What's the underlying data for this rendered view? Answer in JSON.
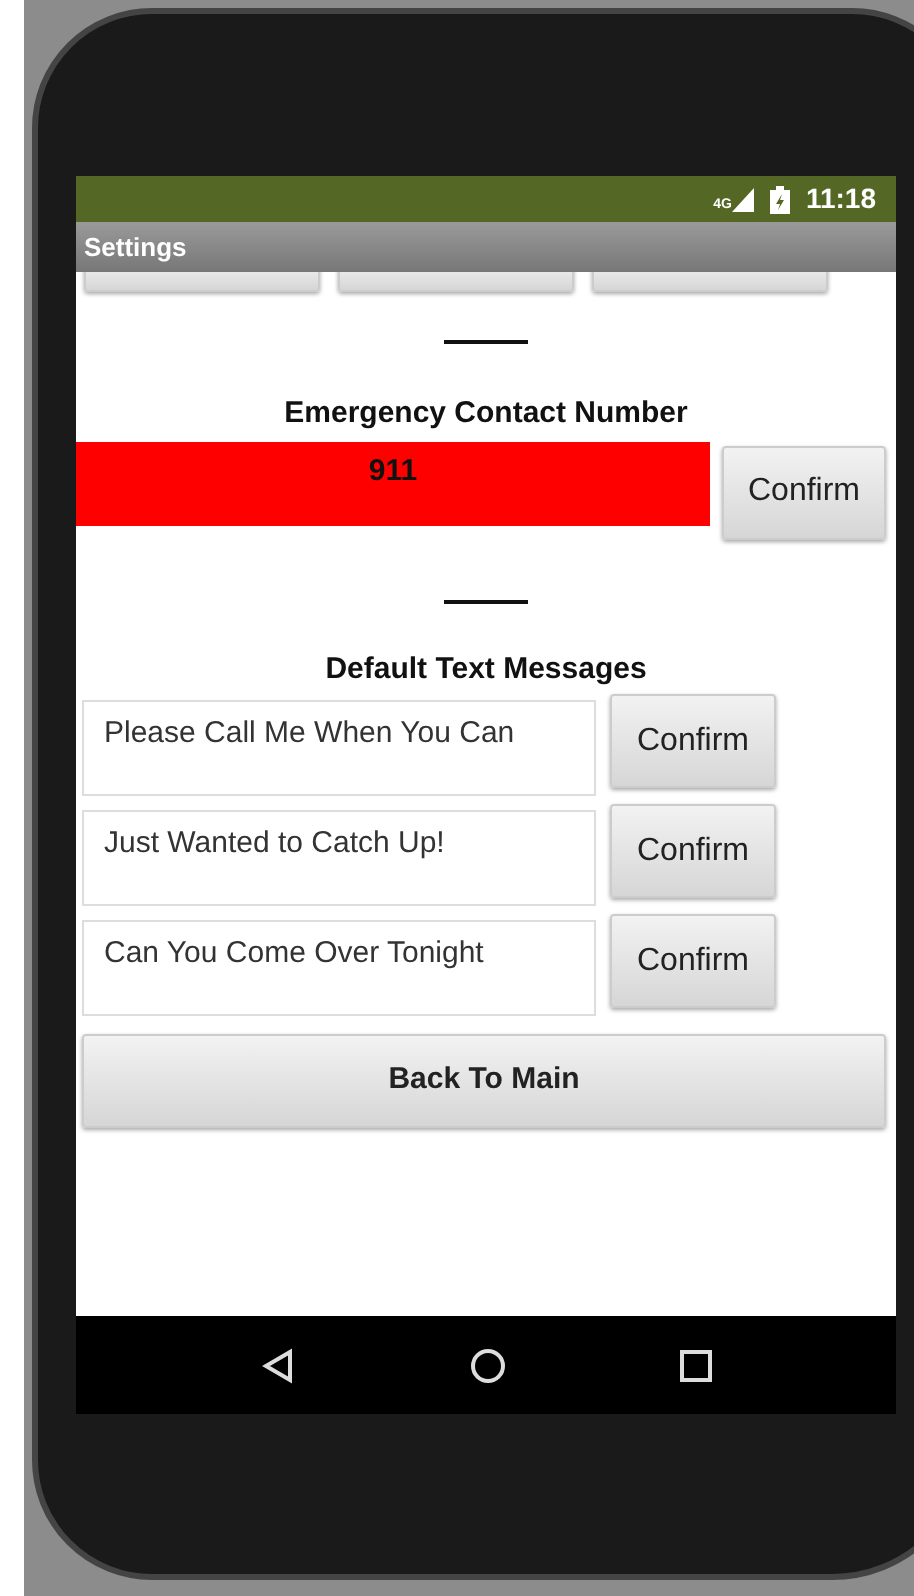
{
  "status_bar": {
    "network": "4G",
    "time": "11:18"
  },
  "title_bar": {
    "title": "Settings"
  },
  "top_buttons": [
    {
      "kind": "button"
    },
    {
      "kind": "button"
    },
    {
      "kind": "button"
    }
  ],
  "emergency": {
    "heading": "Emergency Contact Number",
    "value": "911",
    "button": "Confirm"
  },
  "messages": {
    "heading": "Default Text Messages",
    "items": [
      {
        "value": "Please Call Me When You Can",
        "button": "Confirm"
      },
      {
        "value": "Just Wanted to Catch Up!",
        "button": "Confirm"
      },
      {
        "value": "Can You Come Over Tonight",
        "button": "Confirm"
      }
    ]
  },
  "back_button": "Back To Main"
}
